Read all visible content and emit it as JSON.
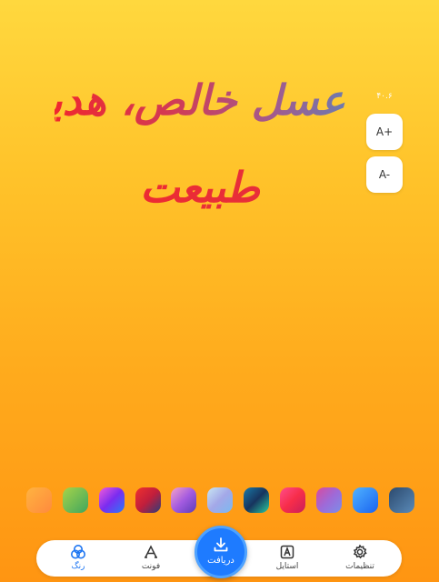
{
  "headline": {
    "line1": "عسل خالص، هدیه",
    "line2": "طبیعت"
  },
  "font_size": {
    "value": "۴۰.۶",
    "increase_label": "A+",
    "decrease_label": "A-"
  },
  "swatches": [
    {
      "name": "swatch-orange-peach",
      "colors": [
        "#FFB340",
        "#FF8A3D"
      ]
    },
    {
      "name": "swatch-lime-green",
      "colors": [
        "#A6D34A",
        "#3FA65E"
      ]
    },
    {
      "name": "swatch-purple-blue",
      "colors": [
        "#F05BDA",
        "#7A2CF0",
        "#2A7BF5"
      ]
    },
    {
      "name": "swatch-red-navy",
      "colors": [
        "#F0302E",
        "#C11E3C",
        "#2B3E7A"
      ]
    },
    {
      "name": "swatch-pink-violet",
      "colors": [
        "#F5A3C9",
        "#A45BE0",
        "#5C3DB8"
      ]
    },
    {
      "name": "swatch-pastel-cyan",
      "colors": [
        "#C8E6F2",
        "#A3A8E8",
        "#7AB9F0"
      ]
    },
    {
      "name": "swatch-teal-navy",
      "colors": [
        "#1A7AA8",
        "#17345E",
        "#2ACB9D"
      ]
    },
    {
      "name": "swatch-pink-red",
      "colors": [
        "#FF4D8A",
        "#F72D4A",
        "#C91E5A"
      ]
    },
    {
      "name": "swatch-rose-lavender",
      "colors": [
        "#D84BA0",
        "#9E6AD8",
        "#7B8EE8"
      ]
    },
    {
      "name": "swatch-sky-blue",
      "colors": [
        "#4FB2FF",
        "#1A63F0"
      ]
    },
    {
      "name": "swatch-slate-blue",
      "colors": [
        "#2C4A6E",
        "#5A8AB8"
      ]
    }
  ],
  "bottom_nav": {
    "color": {
      "label": "رنگ",
      "icon": "color-circles-icon",
      "active": true
    },
    "font": {
      "label": "فونت",
      "icon": "font-a-icon"
    },
    "download": {
      "label": "دریافت",
      "icon": "download-icon"
    },
    "style": {
      "label": "استایل",
      "icon": "style-frame-icon"
    },
    "settings": {
      "label": "تنظیمات",
      "icon": "gear-icon"
    }
  },
  "colors": {
    "accent": "#1E7BFF",
    "headline_gradient": [
      "#F0272E",
      "#D23A54",
      "#A25A8E",
      "#6E7AAE"
    ]
  }
}
